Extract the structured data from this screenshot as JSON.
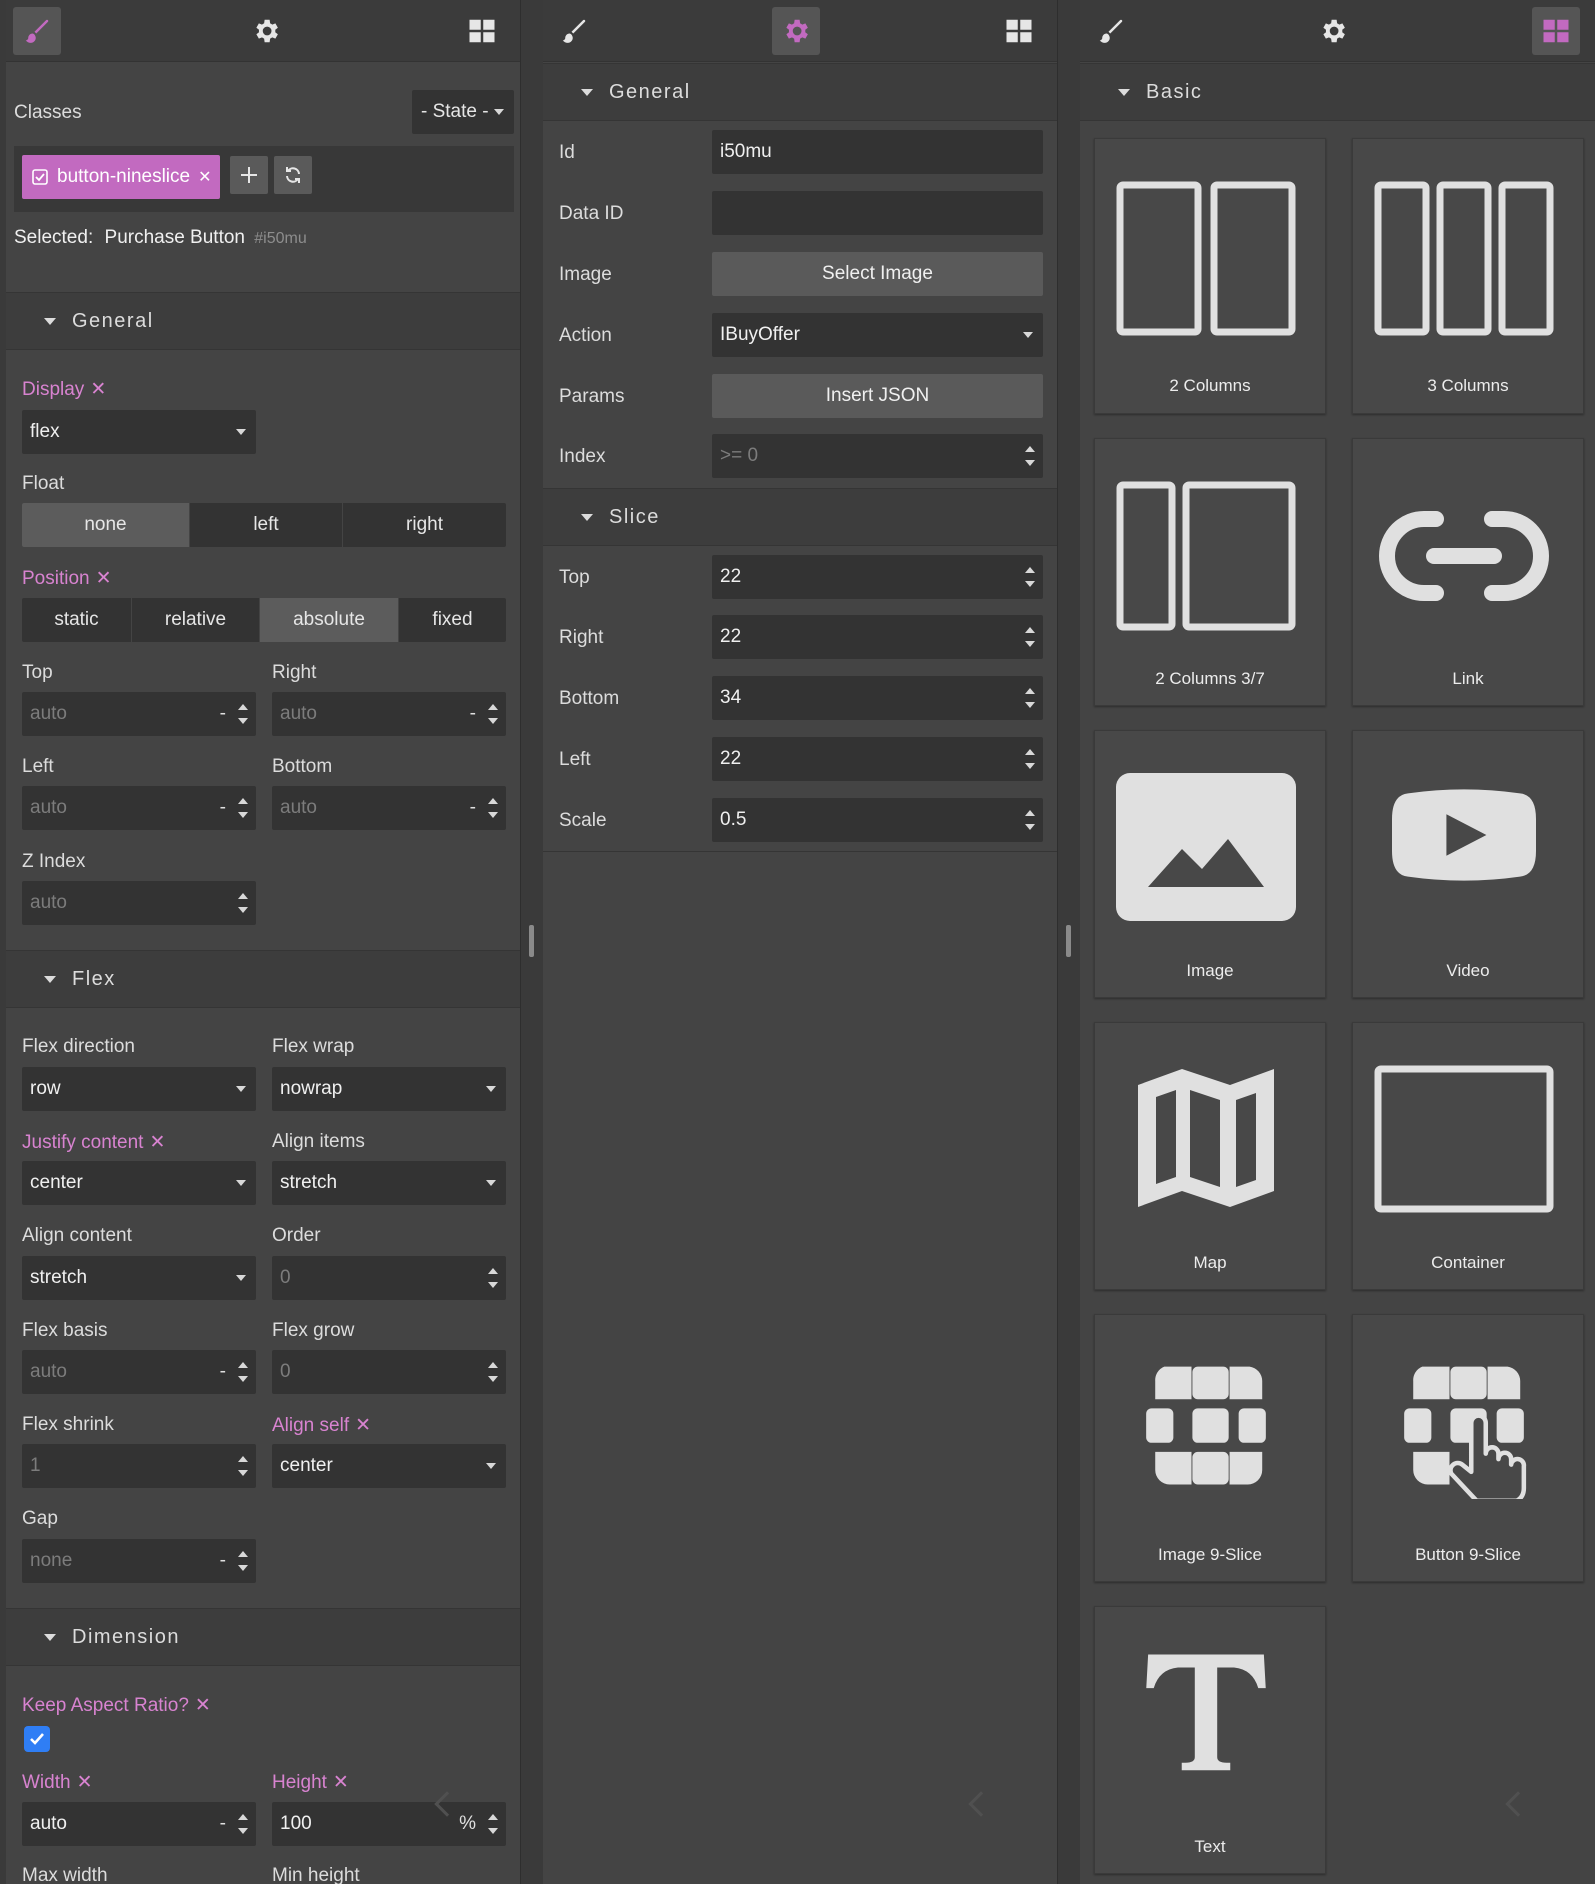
{
  "style_panel": {
    "classes_label": "Classes",
    "state_select": "- State -",
    "class_tag": "button-nineslice",
    "selected_label": "Selected:",
    "selected_name": "Purchase Button",
    "selected_id": "#i50mu",
    "sections": {
      "general": "General",
      "flex": "Flex",
      "dimension": "Dimension"
    },
    "display": {
      "label": "Display",
      "value": "flex"
    },
    "float": {
      "label": "Float",
      "options": [
        "none",
        "left",
        "right"
      ],
      "selected": "none"
    },
    "position": {
      "label": "Position",
      "options": [
        "static",
        "relative",
        "absolute",
        "fixed"
      ],
      "selected": "absolute"
    },
    "top": {
      "label": "Top",
      "value": "auto",
      "unit": "-"
    },
    "right": {
      "label": "Right",
      "value": "auto",
      "unit": "-"
    },
    "left": {
      "label": "Left",
      "value": "auto",
      "unit": "-"
    },
    "bottom": {
      "label": "Bottom",
      "value": "auto",
      "unit": "-"
    },
    "z_index": {
      "label": "Z Index",
      "value": "auto"
    },
    "flex_direction": {
      "label": "Flex direction",
      "value": "row"
    },
    "flex_wrap": {
      "label": "Flex wrap",
      "value": "nowrap"
    },
    "justify_content": {
      "label": "Justify content",
      "value": "center"
    },
    "align_items": {
      "label": "Align items",
      "value": "stretch"
    },
    "align_content": {
      "label": "Align content",
      "value": "stretch"
    },
    "order": {
      "label": "Order",
      "value": "0"
    },
    "flex_basis": {
      "label": "Flex basis",
      "value": "auto",
      "unit": "-"
    },
    "flex_grow": {
      "label": "Flex grow",
      "value": "0"
    },
    "flex_shrink": {
      "label": "Flex shrink",
      "value": "1"
    },
    "align_self": {
      "label": "Align self",
      "value": "center"
    },
    "gap": {
      "label": "Gap",
      "value": "none",
      "unit": "-"
    },
    "keep_aspect": {
      "label": "Keep Aspect Ratio?",
      "checked": true
    },
    "width": {
      "label": "Width",
      "value": "auto",
      "unit": "-"
    },
    "height": {
      "label": "Height",
      "value": "100",
      "unit": "%"
    },
    "max_width": {
      "label": "Max width"
    },
    "min_height": {
      "label": "Min height"
    },
    "remove_mark": "✕"
  },
  "settings_panel": {
    "sections": {
      "general": "General",
      "slice": "Slice"
    },
    "id": {
      "label": "Id",
      "value": "i50mu"
    },
    "data_id": {
      "label": "Data ID",
      "value": ""
    },
    "image": {
      "label": "Image",
      "button": "Select Image"
    },
    "action": {
      "label": "Action",
      "value": "IBuyOffer"
    },
    "params": {
      "label": "Params",
      "button": "Insert JSON"
    },
    "index": {
      "label": "Index",
      "placeholder": ">= 0"
    },
    "slice_top": {
      "label": "Top",
      "value": "22"
    },
    "slice_right": {
      "label": "Right",
      "value": "22"
    },
    "slice_bottom": {
      "label": "Bottom",
      "value": "34"
    },
    "slice_left": {
      "label": "Left",
      "value": "22"
    },
    "scale": {
      "label": "Scale",
      "value": "0.5"
    }
  },
  "blocks_panel": {
    "section": "Basic",
    "blocks": [
      "2 Columns",
      "3 Columns",
      "2 Columns 3/7",
      "Link",
      "Image",
      "Video",
      "Map",
      "Container",
      "Image 9-Slice",
      "Button 9-Slice",
      "Text"
    ]
  },
  "colors": {
    "accent": "#c26ac0",
    "panel": "#444444",
    "field": "#333333",
    "check": "#2f7ef5"
  }
}
